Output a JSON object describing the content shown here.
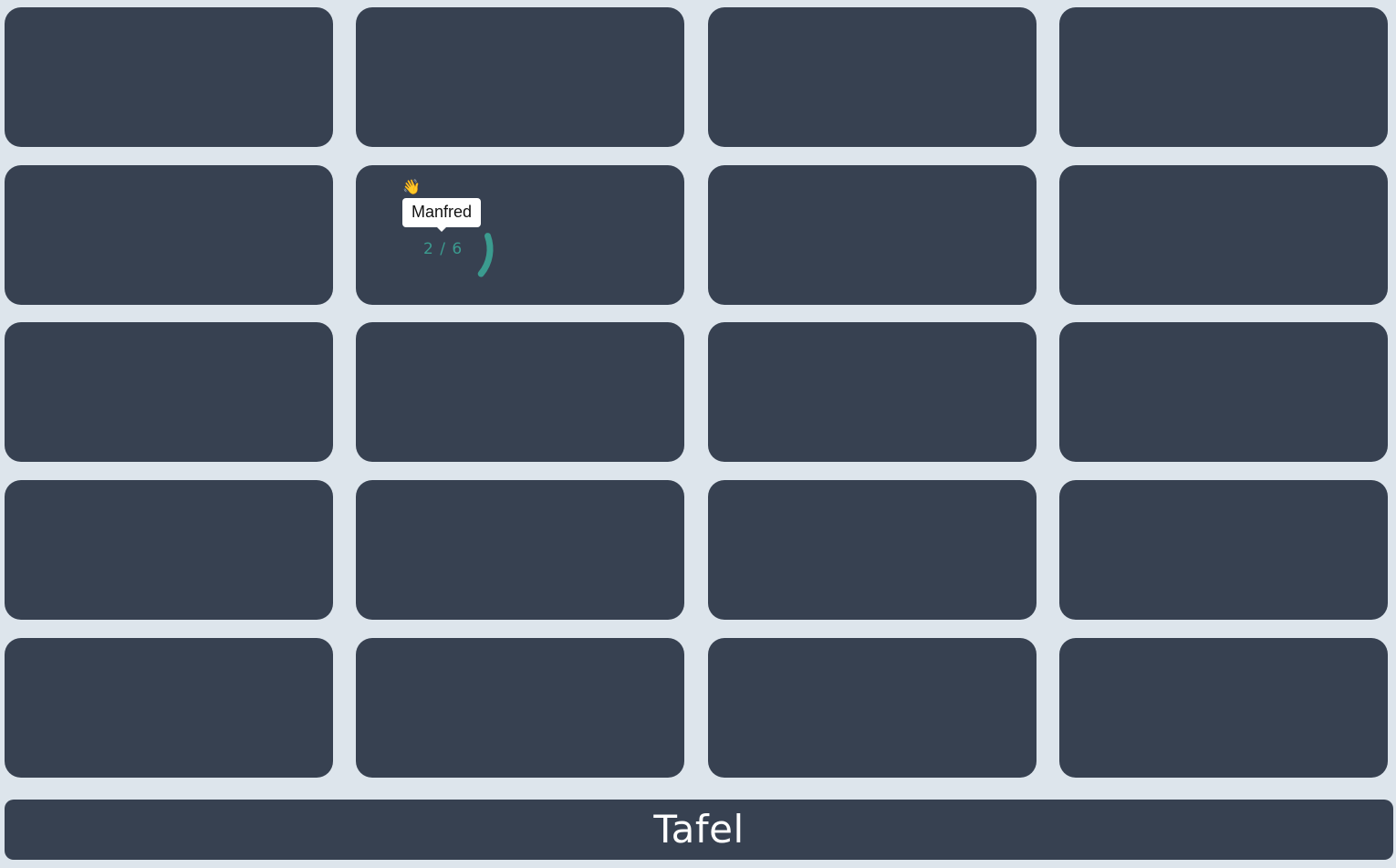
{
  "classroom": {
    "desks": [
      {
        "row": 1,
        "col": 1
      },
      {
        "row": 1,
        "col": 2
      },
      {
        "row": 1,
        "col": 3
      },
      {
        "row": 1,
        "col": 4
      },
      {
        "row": 2,
        "col": 1
      },
      {
        "row": 2,
        "col": 2
      },
      {
        "row": 2,
        "col": 3
      },
      {
        "row": 2,
        "col": 4
      },
      {
        "row": 3,
        "col": 1
      },
      {
        "row": 3,
        "col": 2
      },
      {
        "row": 3,
        "col": 3
      },
      {
        "row": 3,
        "col": 4
      },
      {
        "row": 4,
        "col": 1
      },
      {
        "row": 4,
        "col": 2
      },
      {
        "row": 4,
        "col": 3
      },
      {
        "row": 4,
        "col": 4
      },
      {
        "row": 5,
        "col": 1
      },
      {
        "row": 5,
        "col": 2
      },
      {
        "row": 5,
        "col": 3
      },
      {
        "row": 5,
        "col": 4
      }
    ],
    "board_label": "Tafel"
  },
  "student": {
    "name": "Manfred",
    "progress_text": "2 / 6",
    "progress_done": 2,
    "progress_total": 6,
    "icon": "waving-hand-icon",
    "icon_glyph": "👋",
    "accent_color": "#3b9b8f"
  },
  "colors": {
    "background": "#dde5ec",
    "desk": "#374151",
    "board_text": "#ffffff",
    "tooltip_bg": "#ffffff"
  }
}
